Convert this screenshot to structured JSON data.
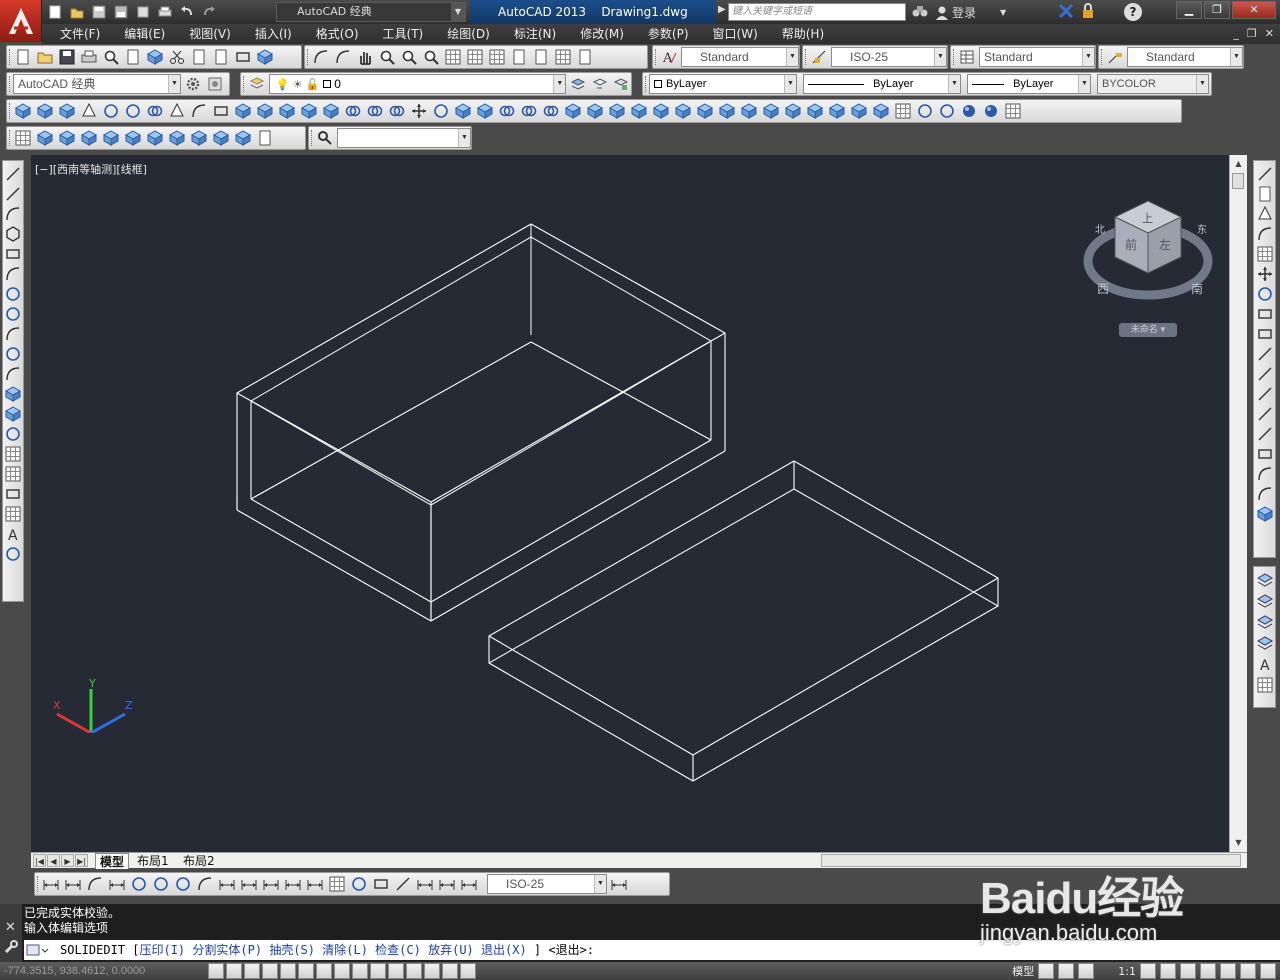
{
  "app": {
    "name": "AutoCAD 2013",
    "document": "Drawing1.dwg",
    "workspace": "AutoCAD 经典",
    "search_placeholder": "键入关键字或短语",
    "login": "登录"
  },
  "menu": [
    "文件(F)",
    "编辑(E)",
    "视图(V)",
    "插入(I)",
    "格式(O)",
    "工具(T)",
    "绘图(D)",
    "标注(N)",
    "修改(M)",
    "参数(P)",
    "窗口(W)",
    "帮助(H)"
  ],
  "styles": {
    "text_style": "Standard",
    "dim_style": "ISO-25",
    "table_style": "Standard",
    "mleader_style": "Standard"
  },
  "layers": {
    "workspace_combo": "AutoCAD 经典",
    "current_layer": "0",
    "color": "ByLayer",
    "linetype": "ByLayer",
    "lineweight": "ByLayer",
    "plotstyle": "BYCOLOR"
  },
  "viewport": {
    "label": "[−][西南等轴测][线框]",
    "viewcube": {
      "top": "上",
      "front_faces": [
        "前",
        "左"
      ],
      "compass": [
        "北",
        "西",
        "南",
        "东"
      ],
      "ucs_label": "未命名"
    },
    "ucs_axes": [
      "X",
      "Y",
      "Z"
    ]
  },
  "tabs": [
    "模型",
    "布局1",
    "布局2"
  ],
  "dim_style_bottom": "ISO-25",
  "command": {
    "history": [
      "已完成实体校验。",
      "输入体编辑选项"
    ],
    "prompt": "SOLIDEDIT",
    "options": [
      "压印(I)",
      "分割实体(P)",
      "抽壳(S)",
      "清除(L)",
      "检查(C)",
      "放弃(U)",
      "退出(X)"
    ],
    "default": "<退出>:"
  },
  "status": {
    "coords": "-774.3515, 938.4612, 0.0000",
    "model": "模型",
    "scale": "1:1"
  },
  "watermark": {
    "brand": "Baidu经验",
    "url": "jingyan.baidu.com"
  },
  "colors": {
    "canvas": "#252a34",
    "title_accent": "#1c4e8c",
    "logo_red": "#d63a2a"
  }
}
